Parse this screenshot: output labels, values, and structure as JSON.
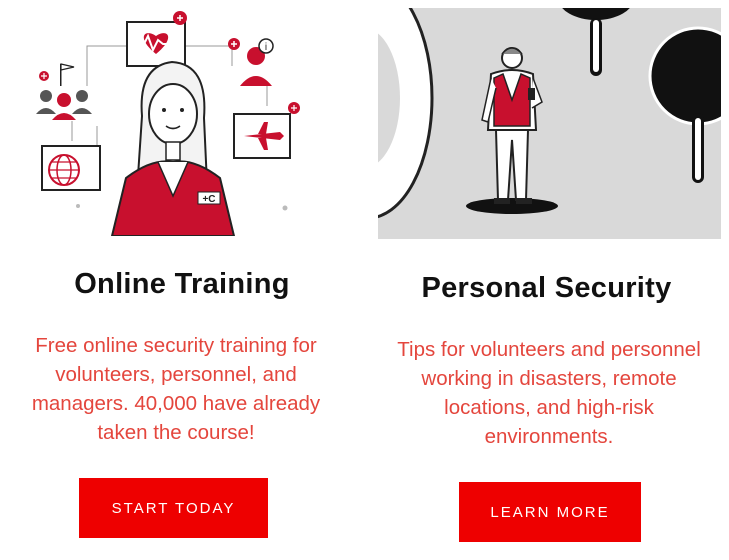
{
  "cards": [
    {
      "title": "Online Training",
      "description": "Free online security training for volunteers, personnel, and managers. 40,000 have already taken the course!",
      "button_label": "START TODAY",
      "illustration_icons": [
        "heart-monitor-icon",
        "team-icon",
        "globe-icon",
        "airplane-icon",
        "info-icon",
        "flag-icon"
      ]
    },
    {
      "title": "Personal Security",
      "description": "Tips for volunteers and personnel working in disasters, remote locations, and high-risk environments.",
      "button_label": "LEARN MORE",
      "illustration_icons": [
        "volunteer-figure-icon",
        "spotlight-icon"
      ]
    }
  ],
  "colors": {
    "accent_red": "#ee0000",
    "text_red": "#e4463d",
    "vest_red": "#c8102e",
    "dark": "#111111",
    "gray_panel": "#d9d9d9"
  }
}
